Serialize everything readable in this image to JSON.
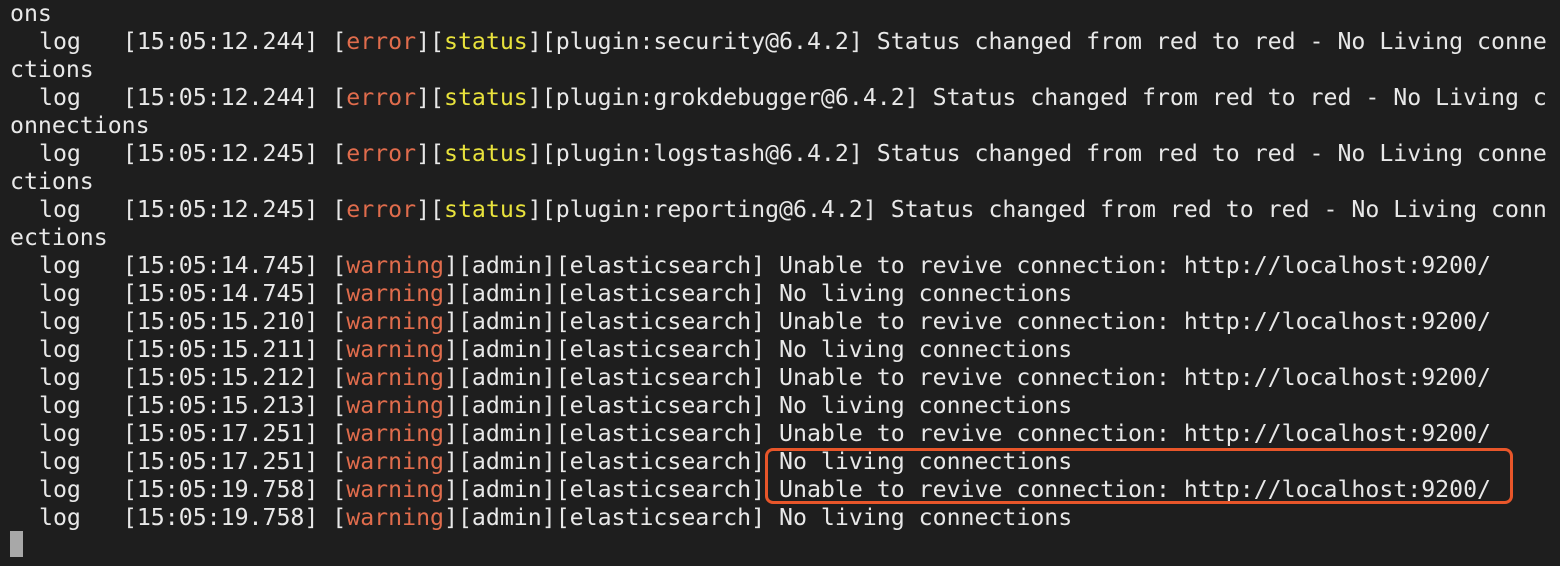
{
  "terminal": {
    "lines": [
      {
        "type": "text",
        "text": "ons"
      },
      {
        "type": "log",
        "prefix": "log",
        "time": "[15:05:12.244]",
        "level": "error",
        "tag2": "status",
        "rest": "[plugin:security@6.4.2] Status changed from red to red - No Living conne"
      },
      {
        "type": "text",
        "text": "ctions"
      },
      {
        "type": "log",
        "prefix": "log",
        "time": "[15:05:12.244]",
        "level": "error",
        "tag2": "status",
        "rest": "[plugin:grokdebugger@6.4.2] Status changed from red to red - No Living c"
      },
      {
        "type": "text",
        "text": "onnections"
      },
      {
        "type": "log",
        "prefix": "log",
        "time": "[15:05:12.245]",
        "level": "error",
        "tag2": "status",
        "rest": "[plugin:logstash@6.4.2] Status changed from red to red - No Living conne"
      },
      {
        "type": "text",
        "text": "ctions"
      },
      {
        "type": "log",
        "prefix": "log",
        "time": "[15:05:12.245]",
        "level": "error",
        "tag2": "status",
        "rest": "[plugin:reporting@6.4.2] Status changed from red to red - No Living conn"
      },
      {
        "type": "text",
        "text": "ections"
      },
      {
        "type": "warn",
        "prefix": "log",
        "time": "[15:05:14.745]",
        "level": "warning",
        "rest": "[admin][elasticsearch] Unable to revive connection: http://localhost:9200/"
      },
      {
        "type": "warn",
        "prefix": "log",
        "time": "[15:05:14.745]",
        "level": "warning",
        "rest": "[admin][elasticsearch] No living connections"
      },
      {
        "type": "warn",
        "prefix": "log",
        "time": "[15:05:15.210]",
        "level": "warning",
        "rest": "[admin][elasticsearch] Unable to revive connection: http://localhost:9200/"
      },
      {
        "type": "warn",
        "prefix": "log",
        "time": "[15:05:15.211]",
        "level": "warning",
        "rest": "[admin][elasticsearch] No living connections"
      },
      {
        "type": "warn",
        "prefix": "log",
        "time": "[15:05:15.212]",
        "level": "warning",
        "rest": "[admin][elasticsearch] Unable to revive connection: http://localhost:9200/"
      },
      {
        "type": "warn",
        "prefix": "log",
        "time": "[15:05:15.213]",
        "level": "warning",
        "rest": "[admin][elasticsearch] No living connections"
      },
      {
        "type": "warn",
        "prefix": "log",
        "time": "[15:05:17.251]",
        "level": "warning",
        "rest": "[admin][elasticsearch] Unable to revive connection: http://localhost:9200/"
      },
      {
        "type": "warn",
        "prefix": "log",
        "time": "[15:05:17.251]",
        "level": "warning",
        "rest": "[admin][elasticsearch] No living connections"
      },
      {
        "type": "warn",
        "prefix": "log",
        "time": "[15:05:19.758]",
        "level": "warning",
        "rest": "[admin][elasticsearch] Unable to revive connection: http://localhost:9200/"
      },
      {
        "type": "warn",
        "prefix": "log",
        "time": "[15:05:19.758]",
        "level": "warning",
        "rest": "[admin][elasticsearch] No living connections"
      }
    ]
  },
  "colors": {
    "background": "#1e1e1e",
    "text": "#e8e8e8",
    "error": "#e06c4c",
    "status": "#e8e23c",
    "warning": "#e06c4c",
    "highlight_border": "#e8562a"
  }
}
